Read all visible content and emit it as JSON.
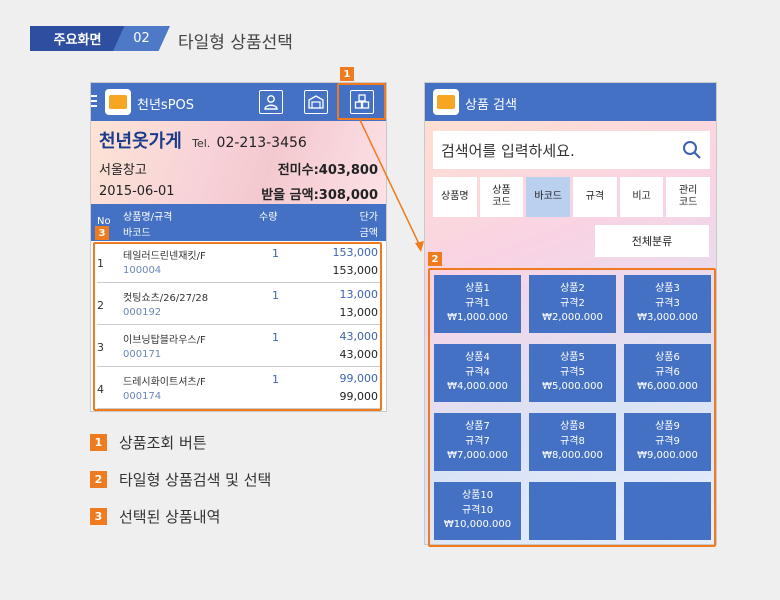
{
  "header": {
    "badge": "주요화면",
    "num": "02",
    "title": "타일형 상품선택"
  },
  "left": {
    "app_name": "천년sPOS",
    "store": {
      "name": "천년옷가게",
      "tel_label": "Tel.",
      "tel": "02-213-3456"
    },
    "warehouse": "서울창고",
    "unpaid": "전미수:403,800",
    "date": "2015-06-01",
    "receivable": "받을 금액:308,000",
    "table_head": {
      "no": "No",
      "name": "상품명/규격",
      "barcode": "바코드",
      "qty": "수량",
      "unit": "단가",
      "amount": "금액"
    },
    "rows": [
      {
        "no": "1",
        "name": "테일러드린넨재킷/F",
        "barcode": "100004",
        "qty": "1",
        "unit": "153,000",
        "amount": "153,000"
      },
      {
        "no": "2",
        "name": "컷팅쇼츠/26/27/28",
        "barcode": "000192",
        "qty": "1",
        "unit": "13,000",
        "amount": "13,000"
      },
      {
        "no": "3",
        "name": "이브닝탑블라우스/F",
        "barcode": "000171",
        "qty": "1",
        "unit": "43,000",
        "amount": "43,000"
      },
      {
        "no": "4",
        "name": "드레시화이트셔츠/F",
        "barcode": "000174",
        "qty": "1",
        "unit": "99,000",
        "amount": "99,000"
      }
    ]
  },
  "right": {
    "title": "상품 검색",
    "search_placeholder": "검색어를 입력하세요.",
    "tabs": [
      {
        "l1": "상품명",
        "l2": ""
      },
      {
        "l1": "상품",
        "l2": "코드"
      },
      {
        "l1": "바코드",
        "l2": ""
      },
      {
        "l1": "규격",
        "l2": ""
      },
      {
        "l1": "비고",
        "l2": ""
      },
      {
        "l1": "관리",
        "l2": "코드"
      }
    ],
    "active_tab": "바코드",
    "category": "전체분류",
    "tiles": [
      {
        "name": "상품1",
        "spec": "규격1",
        "price": "₩1,000.000"
      },
      {
        "name": "상품2",
        "spec": "규격2",
        "price": "₩2,000.000"
      },
      {
        "name": "상품3",
        "spec": "규격3",
        "price": "₩3,000.000"
      },
      {
        "name": "상품4",
        "spec": "규격4",
        "price": "₩4,000.000"
      },
      {
        "name": "상품5",
        "spec": "규격5",
        "price": "₩5,000.000"
      },
      {
        "name": "상품6",
        "spec": "규격6",
        "price": "₩6,000.000"
      },
      {
        "name": "상품7",
        "spec": "규격7",
        "price": "₩7,000.000"
      },
      {
        "name": "상품8",
        "spec": "규격8",
        "price": "₩8,000.000"
      },
      {
        "name": "상품9",
        "spec": "규격9",
        "price": "₩9,000.000"
      },
      {
        "name": "상품10",
        "spec": "규격10",
        "price": "₩10,000.000"
      },
      {
        "name": "",
        "spec": "",
        "price": ""
      },
      {
        "name": "",
        "spec": "",
        "price": ""
      }
    ]
  },
  "callouts": [
    "1",
    "2",
    "3"
  ],
  "legend": [
    {
      "num": "1",
      "text": "상품조회 버튼"
    },
    {
      "num": "2",
      "text": "타일형 상품검색 및 선택"
    },
    {
      "num": "3",
      "text": "선택된 상품내역"
    }
  ],
  "colors": {
    "accent": "#f07a1e",
    "primary": "#4471c3",
    "dark": "#2e4fa0"
  }
}
